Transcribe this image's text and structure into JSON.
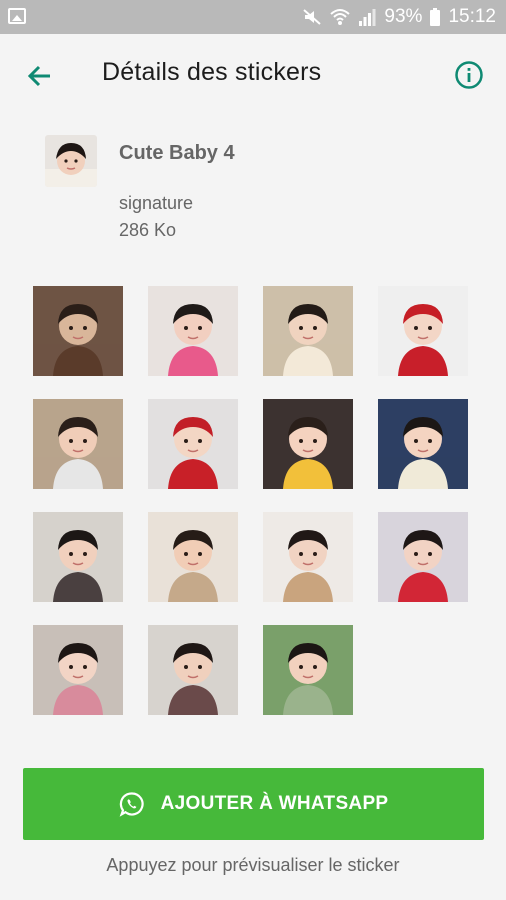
{
  "status_bar": {
    "battery": "93%",
    "time": "15:12",
    "icons": [
      "gallery-icon",
      "mute-icon",
      "wifi-icon",
      "signal-icon",
      "battery-icon"
    ]
  },
  "app_bar": {
    "title": "Détails des stickers",
    "back_icon": "arrow-left-icon",
    "info_icon": "info-icon",
    "accent_color": "#0f8a73"
  },
  "pack": {
    "name": "Cute Baby  4",
    "author": "signature",
    "size": "286 Ko"
  },
  "stickers": [
    {
      "bg": "#6e5444",
      "fg": "#d9b69a",
      "hair": "#2a1e18",
      "shirt": "#5a3b2a"
    },
    {
      "bg": "#e8e2df",
      "fg": "#f2cfc0",
      "hair": "#1f1a18",
      "shirt": "#e85a8b"
    },
    {
      "bg": "#cdbfa9",
      "fg": "#f0d3bf",
      "hair": "#231b17",
      "shirt": "#f3e9d8"
    },
    {
      "bg": "#efefef",
      "fg": "#f3d6c6",
      "hair": "#c61e25",
      "shirt": "#c81f2a"
    },
    {
      "bg": "#b8a48c",
      "fg": "#f0cdb8",
      "hair": "#2a1f1a",
      "shirt": "#e6e6e6"
    },
    {
      "bg": "#e2e0e0",
      "fg": "#f3d6c4",
      "hair": "#c21f27",
      "shirt": "#c82028"
    },
    {
      "bg": "#3c3230",
      "fg": "#f4d2bf",
      "hair": "#2a1f1a",
      "shirt": "#f2c03a"
    },
    {
      "bg": "#2d3f63",
      "fg": "#f4d4c1",
      "hair": "#1c1715",
      "shirt": "#f0ead8"
    },
    {
      "bg": "#d6d2cc",
      "fg": "#f1d0bd",
      "hair": "#1c1715",
      "shirt": "#4a4040"
    },
    {
      "bg": "#e9e1d8",
      "fg": "#f1cdb6",
      "hair": "#261c17",
      "shirt": "#c5a98a"
    },
    {
      "bg": "#eeeae6",
      "fg": "#f1d3c2",
      "hair": "#201816",
      "shirt": "#c9a47e"
    },
    {
      "bg": "#d8d4dc",
      "fg": "#f2d3c4",
      "hair": "#1e1716",
      "shirt": "#d22636"
    },
    {
      "bg": "#c8bfb8",
      "fg": "#f2d4c5",
      "hair": "#1d1614",
      "shirt": "#d88b9c"
    },
    {
      "bg": "#d7d3ce",
      "fg": "#f0d0bd",
      "hair": "#1f1715",
      "shirt": "#6a4a4a"
    },
    {
      "bg": "#7aa06a",
      "fg": "#f2d1be",
      "hair": "#1c1614",
      "shirt": "#9ab38c"
    }
  ],
  "add_button": {
    "label": "AJOUTER À WHATSAPP",
    "icon": "whatsapp-icon",
    "color": "#46b93a"
  },
  "hint": "Appuyez pour prévisualiser le sticker"
}
